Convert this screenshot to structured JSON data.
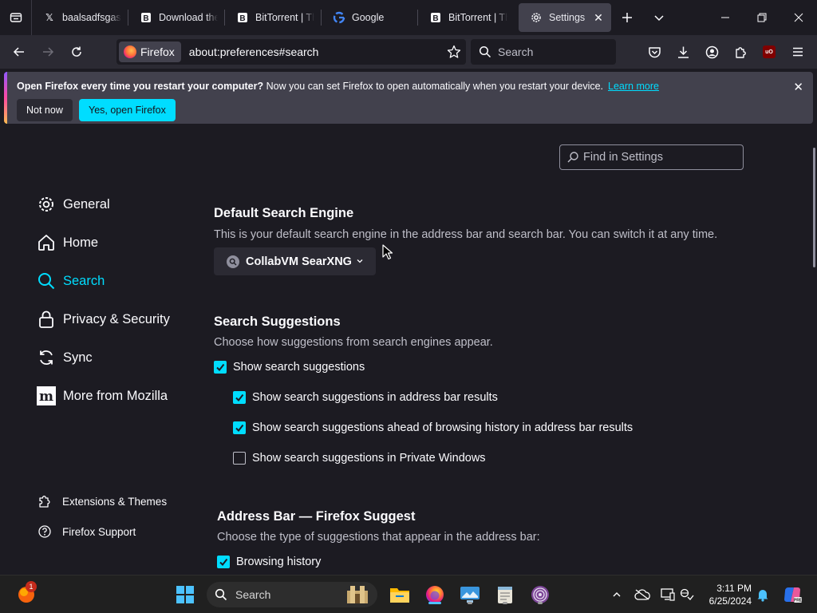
{
  "tabs": [
    {
      "label": "baalsadfsgasfd",
      "favicon": "x-logo-icon",
      "active": false
    },
    {
      "label": "Download the",
      "favicon": "bittorrent-icon",
      "active": false
    },
    {
      "label": "BitTorrent | The",
      "favicon": "bittorrent-icon",
      "active": false
    },
    {
      "label": "Google",
      "favicon": "google-icon",
      "active": false
    },
    {
      "label": "BitTorrent | The",
      "favicon": "bittorrent-icon",
      "active": false
    },
    {
      "label": "Settings",
      "favicon": "gear-icon",
      "active": true
    }
  ],
  "navbar": {
    "identity_label": "Firefox",
    "url": "about:preferences#search",
    "search_placeholder": "Search"
  },
  "notification": {
    "bold_text": "Open Firefox every time you restart your computer?",
    "text": " Now you can set Firefox to open automatically when you restart your device.",
    "link": "Learn more",
    "not_now": "Not now",
    "yes": "Yes, open Firefox"
  },
  "settings": {
    "find_placeholder": "Find in Settings",
    "categories": [
      {
        "label": "General",
        "icon": "gear-icon"
      },
      {
        "label": "Home",
        "icon": "home-icon"
      },
      {
        "label": "Search",
        "icon": "search-icon",
        "selected": true
      },
      {
        "label": "Privacy & Security",
        "icon": "lock-icon"
      },
      {
        "label": "Sync",
        "icon": "sync-icon"
      },
      {
        "label": "More from Mozilla",
        "icon": "mozilla-icon"
      }
    ],
    "footer_links": [
      {
        "label": "Extensions & Themes",
        "icon": "puzzle-icon"
      },
      {
        "label": "Firefox Support",
        "icon": "help-icon"
      }
    ],
    "default_engine": {
      "heading": "Default Search Engine",
      "description": "This is your default search engine in the address bar and search bar. You can switch it at any time.",
      "selected": "CollabVM SearXNG"
    },
    "suggestions": {
      "heading": "Search Suggestions",
      "description": "Choose how suggestions from search engines appear.",
      "options": [
        {
          "label": "Show search suggestions",
          "checked": true
        },
        {
          "label": "Show search suggestions in address bar results",
          "checked": true
        },
        {
          "label": "Show search suggestions ahead of browsing history in address bar results",
          "checked": true
        },
        {
          "label": "Show search suggestions in Private Windows",
          "checked": false
        }
      ]
    },
    "address_bar": {
      "heading": "Address Bar — Firefox Suggest",
      "description": "Choose the type of suggestions that appear in the address bar:",
      "options": [
        {
          "label": "Browsing history",
          "checked": true
        }
      ]
    }
  },
  "taskbar": {
    "weather_badge": "1",
    "search_placeholder": "Search",
    "time": "3:11 PM",
    "date": "6/25/2024"
  },
  "colors": {
    "accent": "#00ddff",
    "background": "#1c1b22",
    "toolbar": "#2b2a33"
  }
}
